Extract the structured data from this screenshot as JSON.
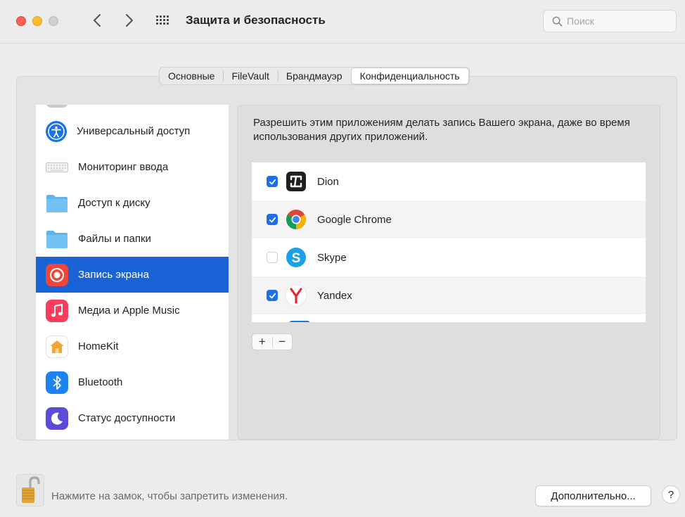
{
  "window": {
    "title": "Защита и безопасность",
    "search_placeholder": "Поиск"
  },
  "tabs": [
    {
      "label": "Основные",
      "active": false
    },
    {
      "label": "FileVault",
      "active": false
    },
    {
      "label": "Брандмауэр",
      "active": false
    },
    {
      "label": "Конфиденциальность",
      "active": true
    }
  ],
  "sidebar": {
    "items": [
      {
        "label": "Универсальный доступ",
        "icon": "accessibility-icon"
      },
      {
        "label": "Мониторинг ввода",
        "icon": "keyboard-icon"
      },
      {
        "label": "Доступ к диску",
        "icon": "folder-icon"
      },
      {
        "label": "Файлы и папки",
        "icon": "folder-icon"
      },
      {
        "label": "Запись экрана",
        "icon": "screen-recording-icon",
        "selected": true
      },
      {
        "label": "Медиа и Apple Music",
        "icon": "music-icon"
      },
      {
        "label": "HomeKit",
        "icon": "home-icon"
      },
      {
        "label": "Bluetooth",
        "icon": "bluetooth-icon"
      },
      {
        "label": "Статус доступности",
        "icon": "moon-icon"
      }
    ]
  },
  "main": {
    "description": "Разрешить этим приложениям делать запись Вашего экрана, даже во время использования других приложений.",
    "apps": [
      {
        "name": "Dion",
        "checked": true,
        "icon": "dion-icon"
      },
      {
        "name": "Google Chrome",
        "checked": true,
        "icon": "chrome-icon"
      },
      {
        "name": "Skype",
        "checked": false,
        "icon": "skype-icon"
      },
      {
        "name": "Yandex",
        "checked": true,
        "icon": "yandex-icon"
      }
    ],
    "add_label": "+",
    "remove_label": "−"
  },
  "footer": {
    "lock_text": "Нажмите на замок, чтобы запретить изменения.",
    "advanced_label": "Дополнительно...",
    "help_label": "?"
  },
  "colors": {
    "selection": "#1a63d6",
    "checkbox": "#1e6ee8"
  }
}
